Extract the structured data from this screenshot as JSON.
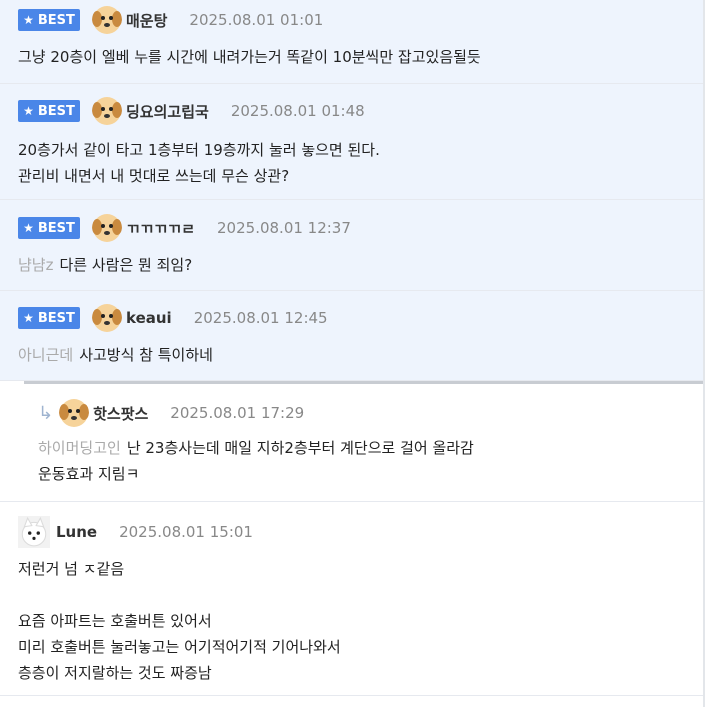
{
  "comments": [
    {
      "best": true,
      "best_label": "BEST",
      "nickname": "매운탕",
      "date": "2025.08.01 01:01",
      "lines": [
        "그냥 20층이 엘베 누를 시간에 내려가는거 똑같이 10분씩만 잡고있음될듯"
      ]
    },
    {
      "best": true,
      "best_label": "BEST",
      "nickname": "딩요의고립국",
      "date": "2025.08.01 01:48",
      "lines": [
        "20층가서 같이 타고 1층부터 19층까지 눌러 놓으면 된다.",
        "관리비 내면서 내 멋대로 쓰는데 무슨 상관?"
      ]
    },
    {
      "best": true,
      "best_label": "BEST",
      "nickname": "ㄲㄲㄲㄲㄹ",
      "date": "2025.08.01 12:37",
      "mention": "냠냠z",
      "lines": [
        "다른 사람은 뭔 죄임?"
      ]
    },
    {
      "best": true,
      "best_label": "BEST",
      "nickname": "keaui",
      "date": "2025.08.01 12:45",
      "mention": "아니근데",
      "lines": [
        "사고방식 참 특이하네"
      ]
    }
  ],
  "reply": {
    "arrow_icon": "reply-arrow-icon",
    "nickname": "핫스팟스",
    "date": "2025.08.01 17:29",
    "mention": "하이머딩고인",
    "lines": [
      "난 23층사는데 매일 지하2층부터 계단으로 걸어 올라감",
      "운동효과 지림ㅋ"
    ]
  },
  "last_comment": {
    "nickname": "Lune",
    "date": "2025.08.01 15:01",
    "lines": [
      "저런거 넘 ㅈ같음",
      "",
      "요즘 아파트는 호출버튼 있어서",
      "미리 호출버튼 눌러놓고는 어기적어기적 기어나와서",
      "층층이 저지랄하는 것도 짜증남"
    ]
  },
  "colors": {
    "best_bg": "#eef4fd",
    "badge": "#4a86e8",
    "date": "#888888",
    "mention": "#aaaaaa"
  }
}
